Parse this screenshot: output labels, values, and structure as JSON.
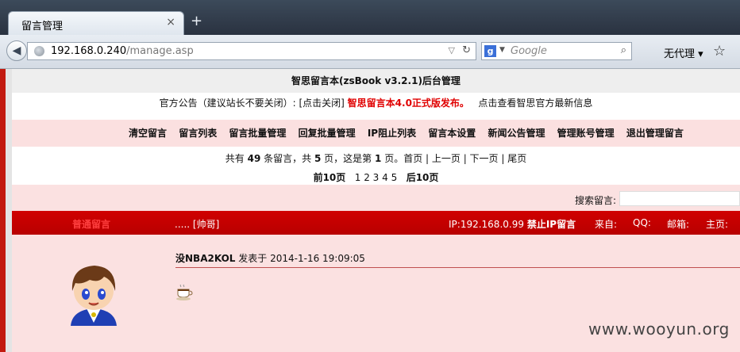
{
  "browser": {
    "tab_title": "留言管理",
    "tab_close": "×",
    "new_tab": "+",
    "url_host": "192.168.0.240",
    "url_path": "/manage.asp",
    "search_placeholder": "Google",
    "search_engine_badge": "g",
    "proxy_label": "无代理",
    "icons": [
      "back-icon",
      "globe-icon",
      "reload-icon",
      "search-icon",
      "bookmark-star-icon"
    ]
  },
  "page": {
    "title": "智思留言本(zsBook v3.2.1)后台管理",
    "notice_prefix": "官方公告（建议站长不要关闭）: [点击关闭]",
    "notice_highlight": "智思留言本4.0正式版发布。",
    "notice_suffix": "点击查看智思官方最新信息",
    "menu": [
      "清空留言",
      "留言列表",
      "留言批量管理",
      "回复批量管理",
      "IP阻止列表",
      "留言本设置",
      "新闻公告管理",
      "管理账号管理",
      "退出管理留言"
    ],
    "pager": {
      "text_a": "共有",
      "total": "49",
      "text_b": "条留言，共",
      "pages": "5",
      "text_c": "页，这是第",
      "current": "1",
      "text_d": "页。首页 | 上一页 | 下一页 | 尾页"
    },
    "page_links": {
      "prev10": "前10页",
      "numbers": [
        "1",
        "2",
        "3",
        "4",
        "5"
      ],
      "next10": "后10页"
    },
    "search_label": "搜索留言:",
    "message_bar": {
      "type": "普通留言",
      "author": "..... [帅哥]",
      "ip": "IP:192.168.0.99",
      "ban_ip": "禁止IP留言",
      "from": "来自:",
      "qq": "QQ:",
      "email": "邮箱:",
      "homepage": "主页:"
    },
    "message": {
      "author": "没NBA2KOL",
      "posted_text": "发表于",
      "datetime": "2014-1-16 19:09:05"
    },
    "watermark": "www.wooyun.org"
  },
  "colors": {
    "accent_red": "#c00000",
    "pink_bg": "#fbe1e1",
    "notice_red": "#e00000"
  }
}
